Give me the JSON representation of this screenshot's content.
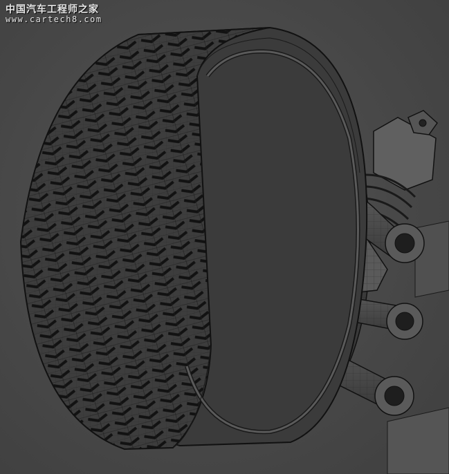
{
  "watermark": {
    "title": "中国汽车工程师之家",
    "url": "www.cartech8.com"
  },
  "colors": {
    "background": "#4a4a4a",
    "tire": "#3a3a3a",
    "wireframe": "#111111",
    "rim": "#505050",
    "suspension": "#5a5a5a"
  }
}
